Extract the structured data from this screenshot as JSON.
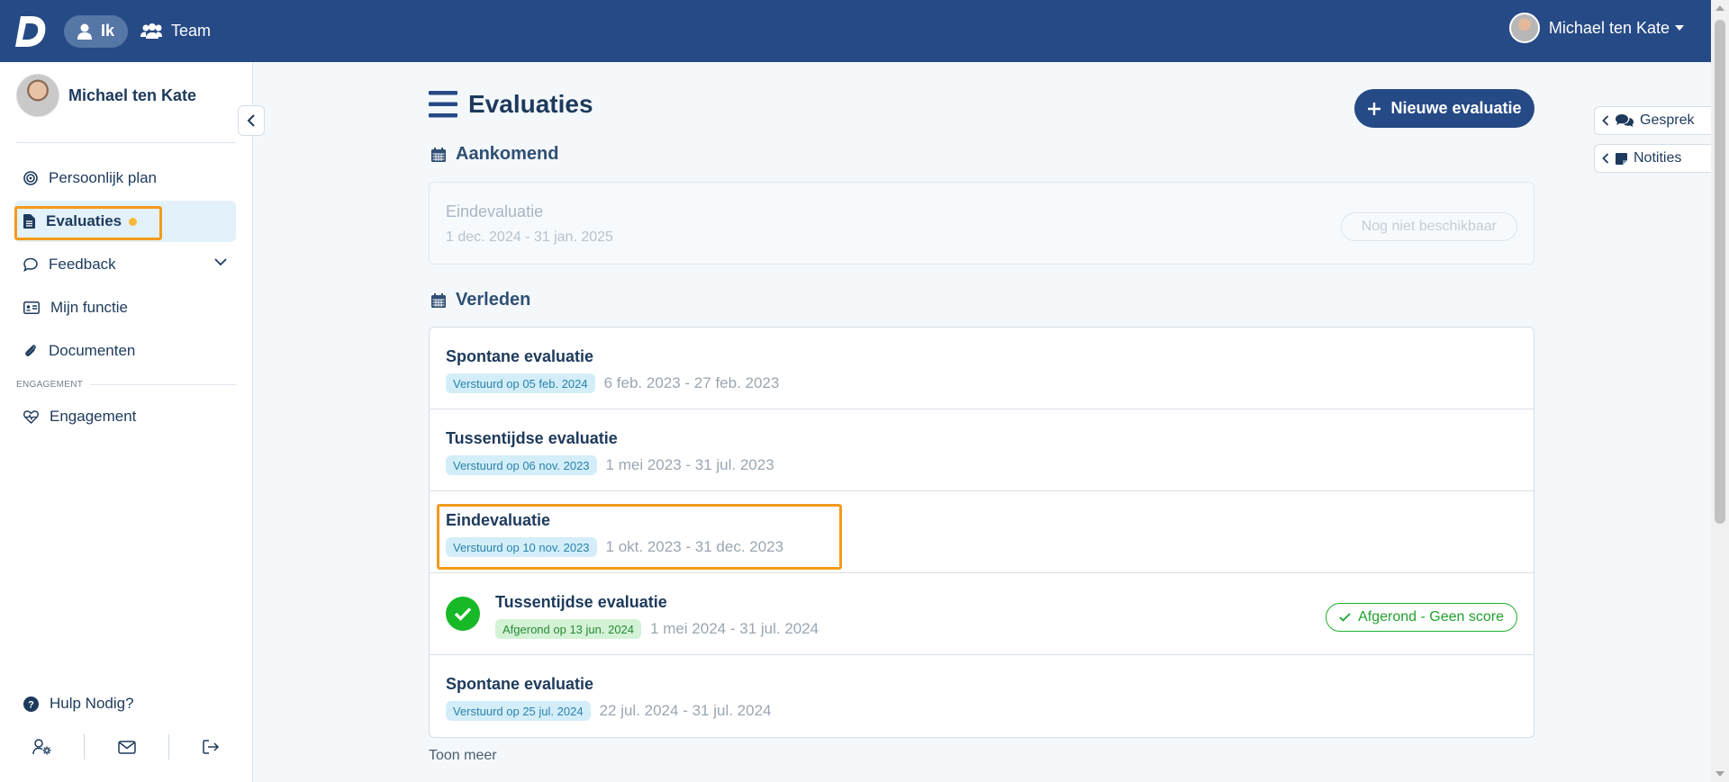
{
  "topbar": {
    "nav": [
      {
        "label": "Ik",
        "icon": "user-icon",
        "active": true
      },
      {
        "label": "Team",
        "icon": "users-icon",
        "active": false
      }
    ],
    "user_name": "Michael ten Kate"
  },
  "sidebar": {
    "profile_name": "Michael ten Kate",
    "items": [
      {
        "label": "Persoonlijk plan",
        "icon": "target-icon"
      },
      {
        "label": "Evaluaties",
        "icon": "file-icon",
        "active": true
      },
      {
        "label": "Feedback",
        "icon": "chat-icon"
      },
      {
        "label": "Mijn functie",
        "icon": "id-card-icon"
      },
      {
        "label": "Documenten",
        "icon": "paperclip-icon"
      }
    ],
    "section_label": "ENGAGEMENT",
    "section_items": [
      {
        "label": "Engagement",
        "icon": "heart-pulse-icon"
      }
    ],
    "help_label": "Hulp Nodig?"
  },
  "main": {
    "title": "Evaluaties",
    "new_button": "Nieuwe evaluatie",
    "upcoming_title": "Aankomend",
    "upcoming": {
      "title": "Eindevaluatie",
      "range": "1 dec. 2024 - 31 jan. 2025",
      "status": "Nog niet beschikbaar"
    },
    "past_title": "Verleden",
    "past": [
      {
        "title": "Spontane evaluatie",
        "badge": "Verstuurd op 05 feb. 2024",
        "range": "6 feb. 2023 - 27 feb. 2023"
      },
      {
        "title": "Tussentijdse evaluatie",
        "badge": "Verstuurd op 06 nov. 2023",
        "range": "1 mei 2023 - 31 jul. 2023"
      },
      {
        "title": "Eindevaluatie",
        "badge": "Verstuurd op 10 nov. 2023",
        "range": "1 okt. 2023 - 31 dec. 2023"
      },
      {
        "title": "Tussentijdse evaluatie",
        "badge": "Afgerond op 13 jun. 2024",
        "range": "1 mei 2024 - 31 jul. 2024",
        "status": "Afgerond - Geen score"
      },
      {
        "title": "Spontane evaluatie",
        "badge": "Verstuurd op 25 jul. 2024",
        "range": "22 jul. 2024 - 31 jul. 2024"
      }
    ],
    "more_label": "Toon meer"
  },
  "side_tabs": [
    {
      "label": "Gesprek",
      "icon": "comments-icon"
    },
    {
      "label": "Notities",
      "icon": "note-icon"
    }
  ],
  "colors": {
    "topbar": "#264a86",
    "accent_orange": "#f39a1b",
    "success": "#17b926"
  }
}
